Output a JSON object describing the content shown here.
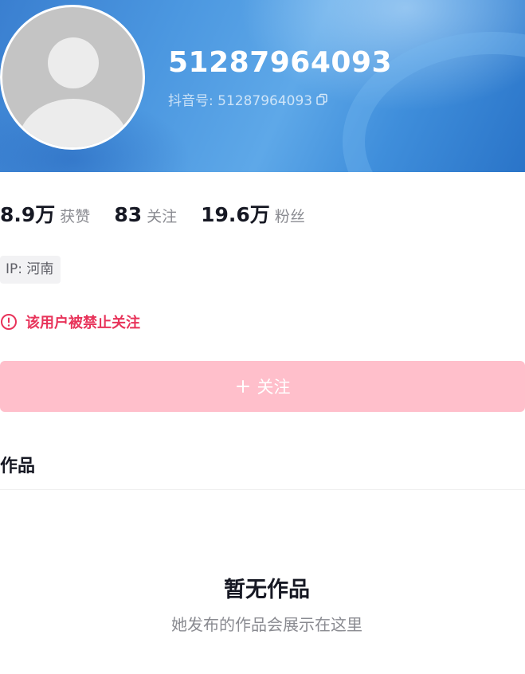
{
  "profile": {
    "display_name": "51287964093",
    "douyin_id_label": "抖音号: 51287964093",
    "avatar": "default-avatar-icon",
    "header_color": "#4b97e0"
  },
  "stats": {
    "likes_value": "8.9万",
    "likes_label": "获赞",
    "following_value": "83",
    "following_label": "关注",
    "followers_value": "19.6万",
    "followers_label": "粉丝"
  },
  "ip_tag": "IP: 河南",
  "warning": {
    "icon": "alert-circle-icon",
    "text": "该用户被禁止关注",
    "color": "#e8335a"
  },
  "follow_button": {
    "icon": "plus-icon",
    "label": "关注",
    "color": "#ffbfcb"
  },
  "works": {
    "section_title": "作品",
    "empty_title": "暂无作品",
    "empty_subtitle": "她发布的作品会展示在这里"
  }
}
